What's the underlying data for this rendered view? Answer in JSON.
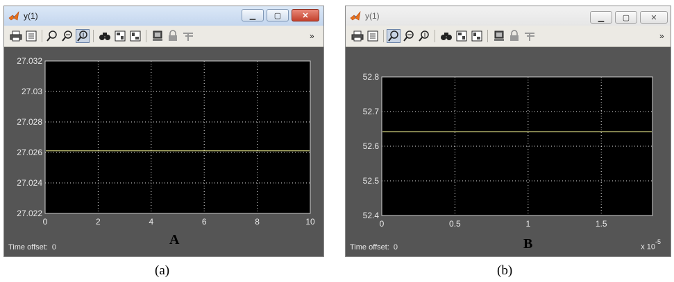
{
  "windows": [
    {
      "title": "y(1)",
      "active": true,
      "pressed_tool": 5,
      "axis": {
        "xlim": [
          0,
          10
        ],
        "ylim": [
          27.022,
          27.032
        ],
        "xticks": [
          "0",
          "2",
          "4",
          "6",
          "8",
          "10"
        ],
        "yticks": [
          "27.022",
          "27.024",
          "27.026",
          "27.028",
          "27.03",
          "27.032"
        ]
      },
      "signal_value": 27.0261,
      "line_color": "#ffff99",
      "time_offset_label": "Time offset:",
      "time_offset_value": "0",
      "multiplier": "",
      "panel_letter": "A",
      "caption": "(a)"
    },
    {
      "title": "y(1)",
      "active": false,
      "pressed_tool": 3,
      "axis": {
        "xlim": [
          0,
          1.85
        ],
        "ylim": [
          52.4,
          52.8
        ],
        "xticks": [
          "0",
          "0.5",
          "1",
          "1.5"
        ],
        "yticks": [
          "52.4",
          "52.5",
          "52.6",
          "52.7",
          "52.8"
        ]
      },
      "signal_value": 52.642,
      "line_color": "#ffff99",
      "time_offset_label": "Time offset:",
      "time_offset_value": "0",
      "multiplier_base": "x 10",
      "multiplier_exp": "-5",
      "panel_letter": "B",
      "caption": "(b)"
    }
  ],
  "toolbar_icons": [
    "print-icon",
    "print-preview-icon",
    "zoom-in-icon",
    "zoom-x-icon",
    "zoom-y-icon",
    "find-icon",
    "save-axes-icon",
    "restore-axes-icon",
    "parameters-icon",
    "lock-icon",
    "signal-selection-icon",
    "toolbar-chevron-icon"
  ]
}
